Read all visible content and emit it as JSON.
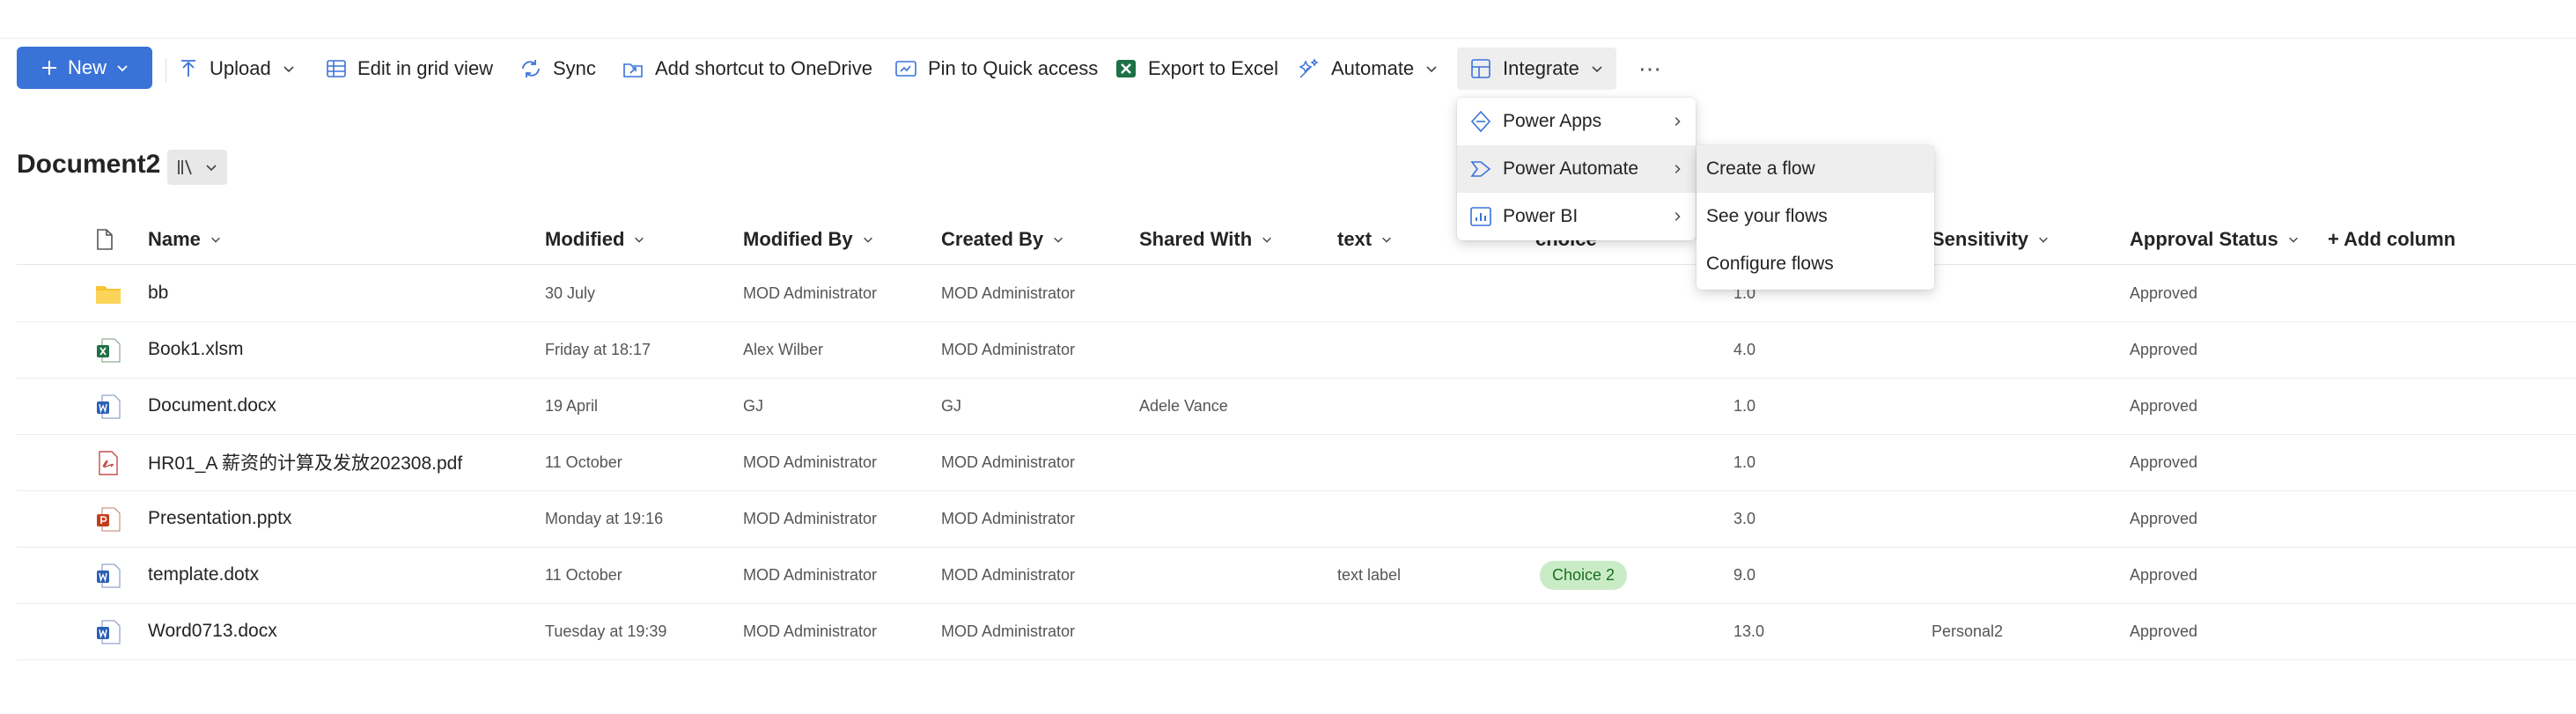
{
  "toolbar": {
    "new_label": "New",
    "upload_label": "Upload",
    "grid_label": "Edit in grid view",
    "sync_label": "Sync",
    "shortcut_label": "Add shortcut to OneDrive",
    "pin_label": "Pin to Quick access",
    "export_label": "Export to Excel",
    "automate_label": "Automate",
    "integrate_label": "Integrate",
    "more_label": "⋯"
  },
  "library": {
    "title": "Document2"
  },
  "columns": {
    "name": "Name",
    "modified": "Modified",
    "modified_by": "Modified By",
    "created_by": "Created By",
    "shared_with": "Shared With",
    "text": "text",
    "choice": "choice",
    "sensitivity": "Sensitivity",
    "approval": "Approval Status",
    "add": "+ Add column"
  },
  "rows": [
    {
      "name": "bb",
      "type": "folder",
      "modified": "30 July",
      "modified_by": "MOD Administrator",
      "created_by": "MOD Administrator",
      "shared_with": "",
      "text": "",
      "choice": "",
      "version": "1.0",
      "sensitivity": "",
      "approval": "Approved"
    },
    {
      "name": "Book1.xlsm",
      "type": "excel",
      "modified": "Friday at 18:17",
      "modified_by": "Alex Wilber",
      "created_by": "MOD Administrator",
      "shared_with": "",
      "text": "",
      "choice": "",
      "version": "4.0",
      "sensitivity": "",
      "approval": "Approved"
    },
    {
      "name": "Document.docx",
      "type": "word",
      "modified": "19 April",
      "modified_by": "GJ",
      "created_by": "GJ",
      "shared_with": "Adele Vance",
      "text": "",
      "choice": "",
      "version": "1.0",
      "sensitivity": "",
      "approval": "Approved"
    },
    {
      "name": "HR01_A 薪资的计算及发放202308.pdf",
      "type": "pdf",
      "modified": "11 October",
      "modified_by": "MOD Administrator",
      "created_by": "MOD Administrator",
      "shared_with": "",
      "text": "",
      "choice": "",
      "version": "1.0",
      "sensitivity": "",
      "approval": "Approved"
    },
    {
      "name": "Presentation.pptx",
      "type": "ppt",
      "modified": "Monday at 19:16",
      "modified_by": "MOD Administrator",
      "created_by": "MOD Administrator",
      "shared_with": "",
      "text": "",
      "choice": "",
      "version": "3.0",
      "sensitivity": "",
      "approval": "Approved"
    },
    {
      "name": "template.dotx",
      "type": "word",
      "modified": "11 October",
      "modified_by": "MOD Administrator",
      "created_by": "MOD Administrator",
      "shared_with": "",
      "text": "text label",
      "choice": "Choice 2",
      "version": "9.0",
      "sensitivity": "",
      "approval": "Approved"
    },
    {
      "name": "Word0713.docx",
      "type": "word",
      "modified": "Tuesday at 19:39",
      "modified_by": "MOD Administrator",
      "created_by": "MOD Administrator",
      "shared_with": "",
      "text": "",
      "choice": "",
      "version": "13.0",
      "sensitivity": "Personal2",
      "approval": "Approved"
    }
  ],
  "integrate_menu": {
    "items": [
      {
        "label": "Power Apps"
      },
      {
        "label": "Power Automate"
      },
      {
        "label": "Power BI"
      }
    ]
  },
  "power_automate_submenu": {
    "items": [
      {
        "label": "Create a flow"
      },
      {
        "label": "See your flows"
      },
      {
        "label": "Configure flows"
      }
    ]
  },
  "colors": {
    "accent": "#3a73d8",
    "chip_bg": "#c9ecc7",
    "chip_text": "#1d6d1f",
    "hover": "#eeeeee"
  }
}
